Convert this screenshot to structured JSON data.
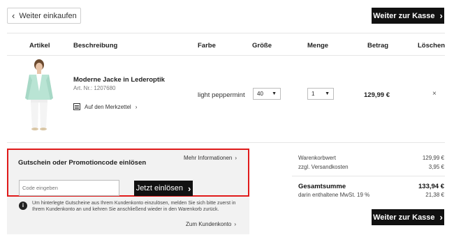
{
  "nav": {
    "back_label": "Weiter einkaufen",
    "checkout_label": "Weiter zur Kasse"
  },
  "table": {
    "headers": [
      "Artikel",
      "Beschreibung",
      "Farbe",
      "Größe",
      "Menge",
      "Betrag",
      "Löschen"
    ]
  },
  "item": {
    "title": "Moderne Jacke in Lederoptik",
    "article_no": "Art. Nr.: 1207680",
    "wishlist_label": "Auf den Merkzettel",
    "color": "light peppermint",
    "size": "40",
    "quantity": "1",
    "price": "129,99 €",
    "remove_symbol": "×"
  },
  "voucher": {
    "title": "Gutschein oder Promotioncode einlösen",
    "more_info": "Mehr Informationen",
    "input_placeholder": "Code eingeben",
    "redeem_label": "Jetzt einlösen",
    "info_text": "Um hinterlegte Gutscheine aus Ihrem Kundenkonto einzulösen, melden Sie sich bitte zuerst in Ihrem Kundenkonto an und kehren Sie anschließend wieder in den Warenkorb zurück.",
    "account_link": "Zum Kundenkonto"
  },
  "summary": {
    "goods_label": "Warenkorbwert",
    "goods_value": "129,99 €",
    "shipping_label": "zzgl. Versandkosten",
    "shipping_value": "3,95 €",
    "total_label": "Gesamtsumme",
    "total_value": "133,94 €",
    "vat_label": "darin enthaltene MwSt. 19 %",
    "vat_value": "21,38 €"
  }
}
